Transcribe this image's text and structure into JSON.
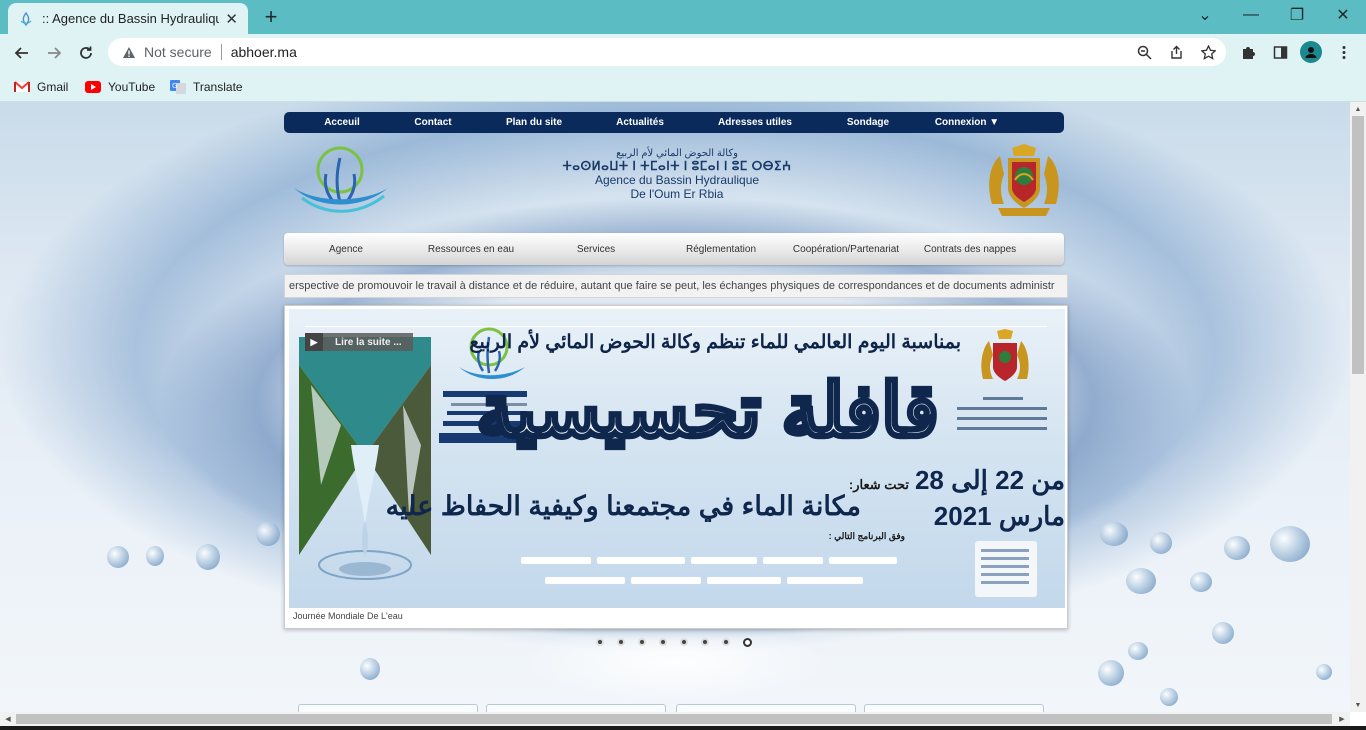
{
  "browser": {
    "tab_title": ":: Agence du Bassin Hydraulique de",
    "new_tab": "+",
    "window_controls": {
      "minimize": "—",
      "restore": "❐",
      "close": "✕",
      "tabs_menu": "⌄"
    },
    "security_label": "Not secure",
    "url": "abhoer.ma",
    "bookmarks": [
      {
        "label": "Gmail",
        "icon": "gmail-icon"
      },
      {
        "label": "YouTube",
        "icon": "youtube-icon"
      },
      {
        "label": "Translate",
        "icon": "translate-icon"
      }
    ]
  },
  "top_nav": [
    "Acceuil",
    "Contact",
    "Plan du site",
    "Actualités",
    "Adresses utiles",
    "Sondage",
    "Connexion ▼"
  ],
  "header": {
    "arabic": "وكالة الحوض المائي لأم الربيع",
    "tifinagh": "ⵜⴰⵙⵍⴰⵡⵜ ⵏ ⵜⵎⴰⵏⵜ ⵏ ⵓⵎⴰⵏ ⵏ ⵓⵎ ⵔⴱⵉⵄ",
    "french_line1": "Agence du Bassin Hydraulique",
    "french_line2": "De l'Oum Er Rbia"
  },
  "main_nav": [
    "Agence",
    "Ressources en eau",
    "Services",
    "Réglementation",
    "Coopération/Partenariat",
    "Contrats des nappes"
  ],
  "ticker_text": "erspective de promouvoir le travail à distance et de réduire, autant que faire se peut, les échanges physiques de correspondances et de documents administr",
  "slider": {
    "more_button": "Lire la suite ...",
    "caption": "Journée Mondiale De L'eau",
    "banner": {
      "heading": "بمناسبة اليوم العالمي للماء تنظم وكالة الحوض المائي لأم الربيع",
      "big_title": "قافلة تحسيسية",
      "slogan_label": "تحت شعار:",
      "slogan": "مكانة الماء في مجتمعنا وكيفية الحفاظ عليه",
      "date_line1": "من 22 إلى 28",
      "date_line2": "مارس 2021",
      "schedule_label": "وفق البرنامج التالي :"
    },
    "dot_count": 8,
    "active_dot": 7
  },
  "colors": {
    "tabbar": "#5cbcc4",
    "toolbar": "#dff3f5",
    "topnav": "#0a2a5c",
    "banner_text": "#0f274d"
  }
}
